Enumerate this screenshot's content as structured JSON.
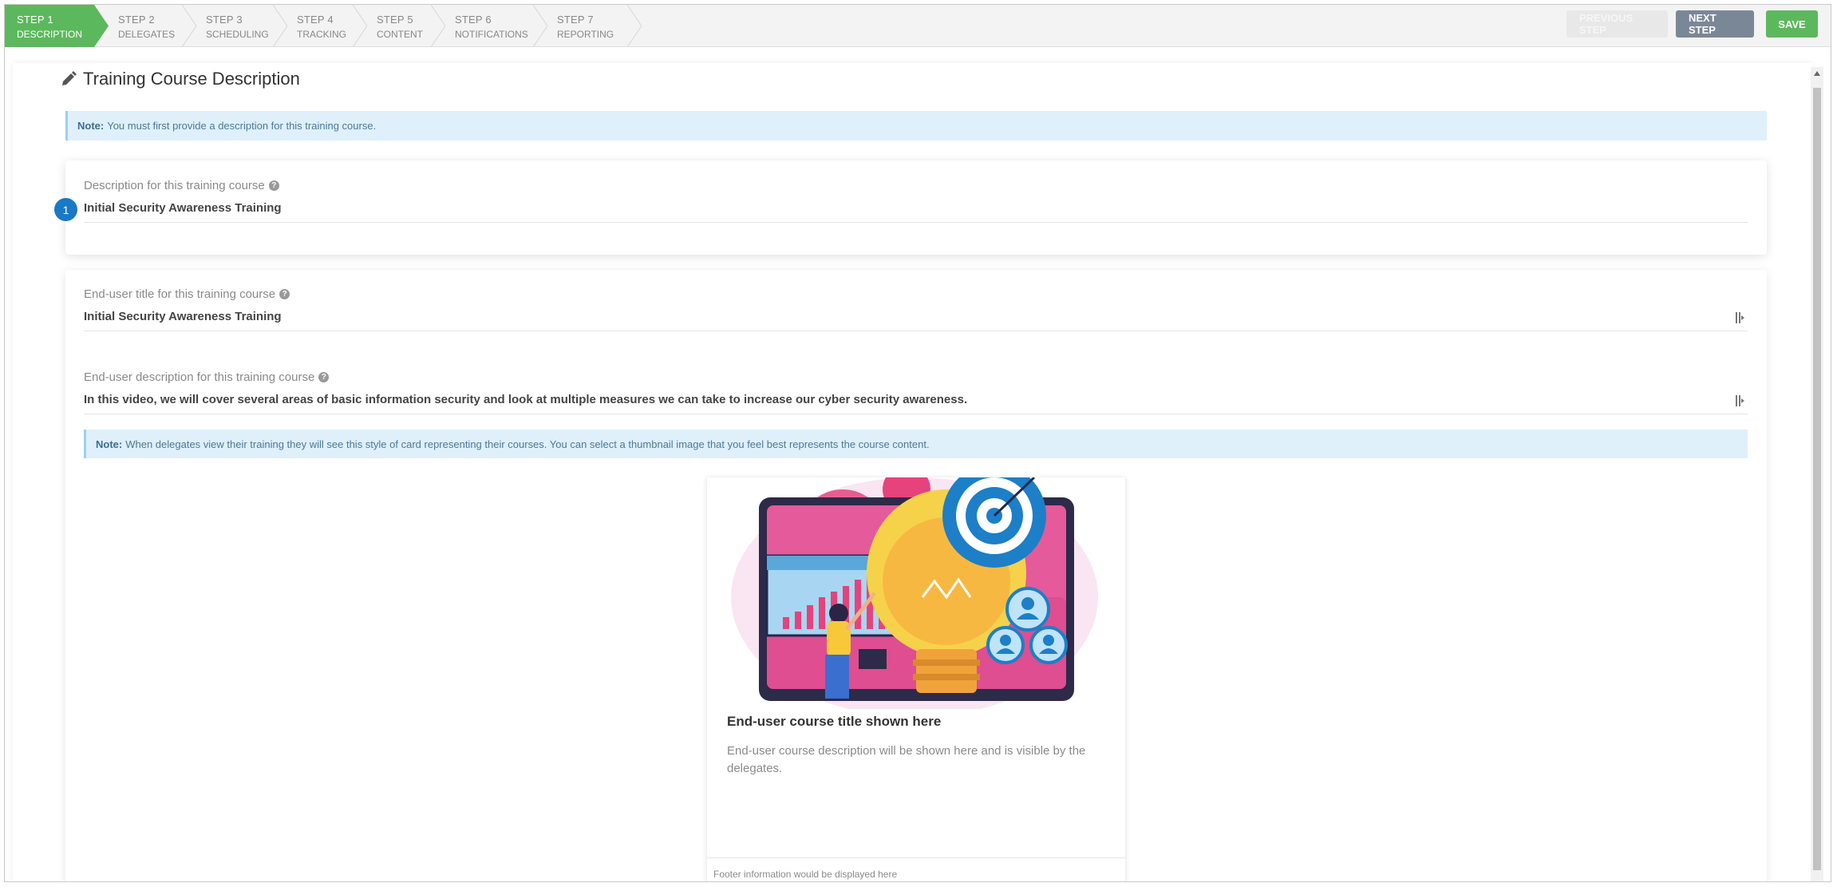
{
  "wizard": {
    "steps": [
      {
        "num": "STEP 1",
        "label": "DESCRIPTION",
        "active": true
      },
      {
        "num": "STEP 2",
        "label": "DELEGATES"
      },
      {
        "num": "STEP 3",
        "label": "SCHEDULING"
      },
      {
        "num": "STEP 4",
        "label": "TRACKING"
      },
      {
        "num": "STEP 5",
        "label": "CONTENT"
      },
      {
        "num": "STEP 6",
        "label": "NOTIFICATIONS"
      },
      {
        "num": "STEP 7",
        "label": "REPORTING"
      }
    ],
    "prev_label": "PREVIOUS STEP",
    "next_label": "NEXT STEP",
    "save_label": "SAVE"
  },
  "page": {
    "title": "Training Course Description",
    "note1_bold": "Note:",
    "note1_text": "You must first provide a description for this training course."
  },
  "description_field": {
    "badge": "1",
    "label": "Description for this training course",
    "value": "Initial Security Awareness Training"
  },
  "enduser_title_field": {
    "label": "End-user title for this training course",
    "value": "Initial Security Awareness Training"
  },
  "enduser_desc_field": {
    "label": "End-user description for this training course",
    "value": "In this video, we will cover several areas of basic information security and look at multiple measures we can take to increase our cyber security awareness."
  },
  "note2": {
    "bold": "Note:",
    "text": "When delegates view their training they will see this style of card representing their courses. You can select a thumbnail image that you feel best represents the course content."
  },
  "preview_card": {
    "title": "End-user course title shown here",
    "description": "End-user course description will be shown here and is visible by the delegates.",
    "footer": "Footer information would be displayed here"
  },
  "colors": {
    "step_active": "#5cb85c",
    "save_button": "#5cb85c",
    "next_button": "#7a8797",
    "badge": "#1a79c4",
    "note_bg": "#dff0fb"
  }
}
